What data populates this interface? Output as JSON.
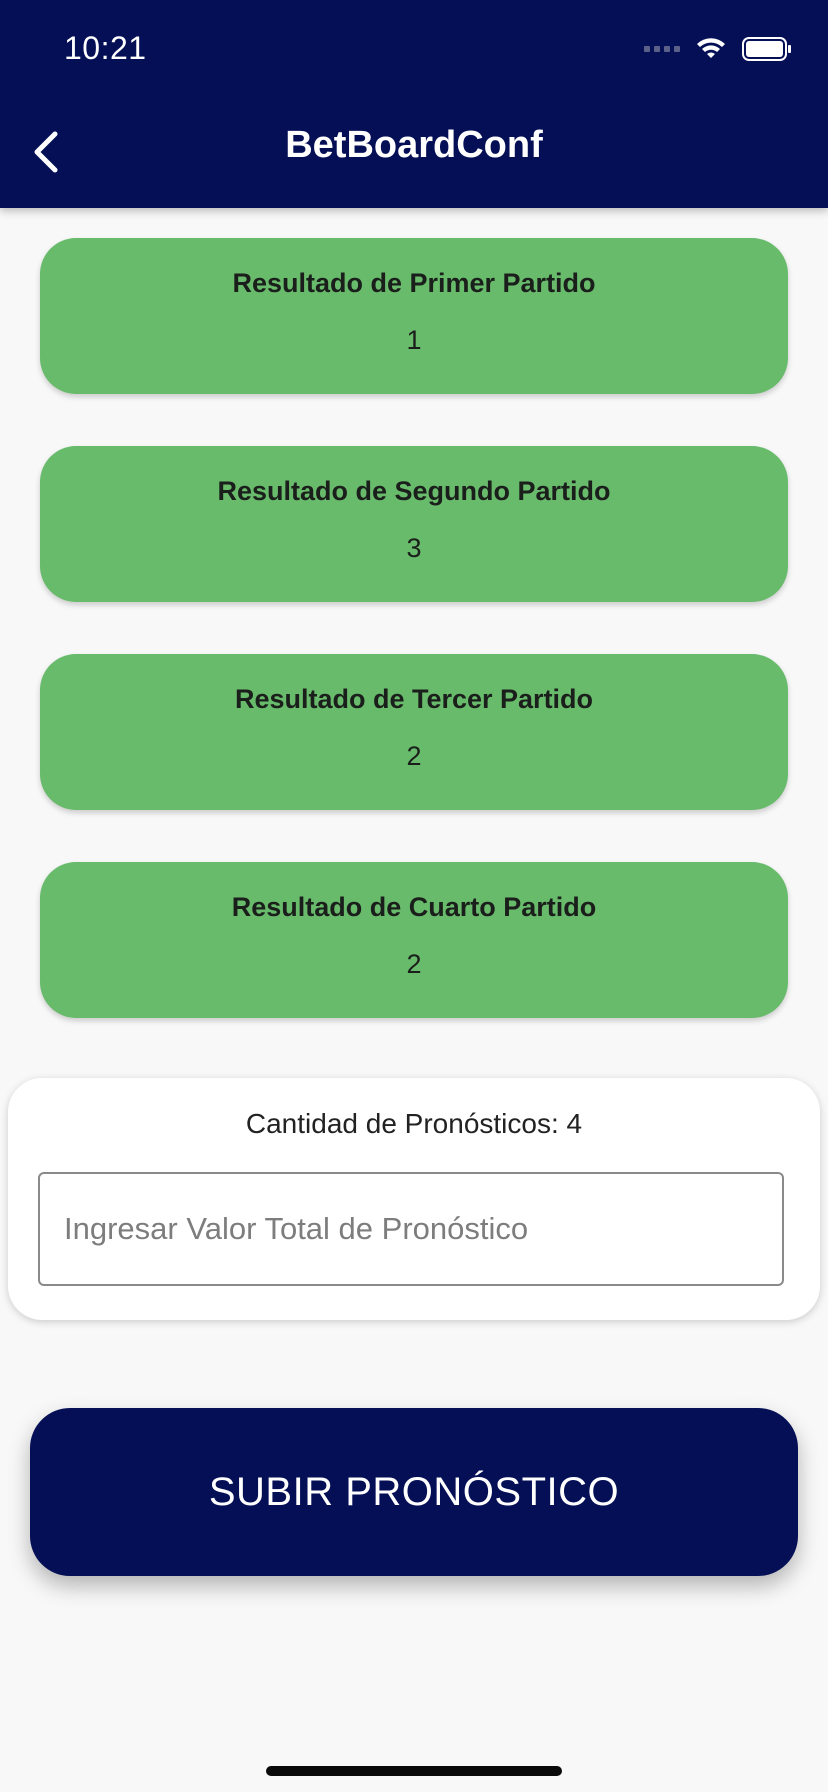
{
  "status_bar": {
    "time": "10:21"
  },
  "app_bar": {
    "title": "BetBoardConf",
    "back_icon": "chevron-left-icon"
  },
  "results": [
    {
      "label": "Resultado de Primer Partido",
      "value": "1"
    },
    {
      "label": "Resultado de Segundo Partido",
      "value": "3"
    },
    {
      "label": "Resultado de Tercer Partido",
      "value": "2"
    },
    {
      "label": "Resultado de Cuarto Partido",
      "value": "2"
    }
  ],
  "panel": {
    "count_label": "Cantidad de Pronósticos: 4",
    "input_placeholder": "Ingresar Valor Total de Pronóstico",
    "input_value": ""
  },
  "submit": {
    "label": "SUBIR PRONÓSTICO"
  },
  "colors": {
    "primary": "#040f56",
    "card_green": "#69bb6c",
    "background": "#f8f8f8"
  }
}
